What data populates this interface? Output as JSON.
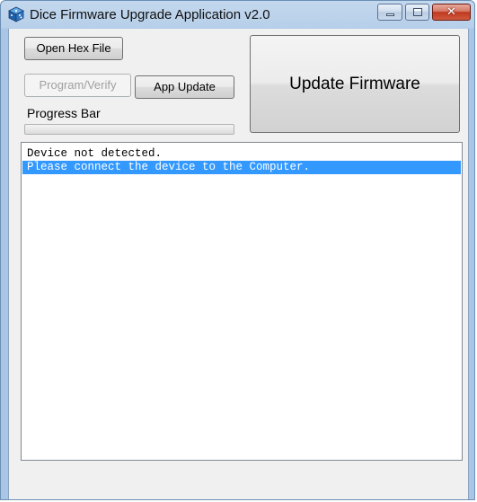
{
  "window": {
    "title": "Dice Firmware Upgrade Application v2.0",
    "close_glyph": "✕",
    "app_icon": "dice-icon"
  },
  "controls": {
    "open_hex_label": "Open Hex File",
    "program_verify_label": "Program/Verify",
    "program_verify_enabled": false,
    "app_update_label": "App Update",
    "update_firmware_label": "Update Firmware",
    "progress_label": "Progress Bar",
    "progress_fraction": 0
  },
  "log": {
    "lines": [
      {
        "text": "Device not detected.",
        "selected": false
      },
      {
        "text": "Please connect the device to the Computer.",
        "selected": true
      }
    ]
  },
  "colors": {
    "selection": "#3399ff",
    "close_button": "#c0391f",
    "title_bar": "#b7cfe9"
  }
}
